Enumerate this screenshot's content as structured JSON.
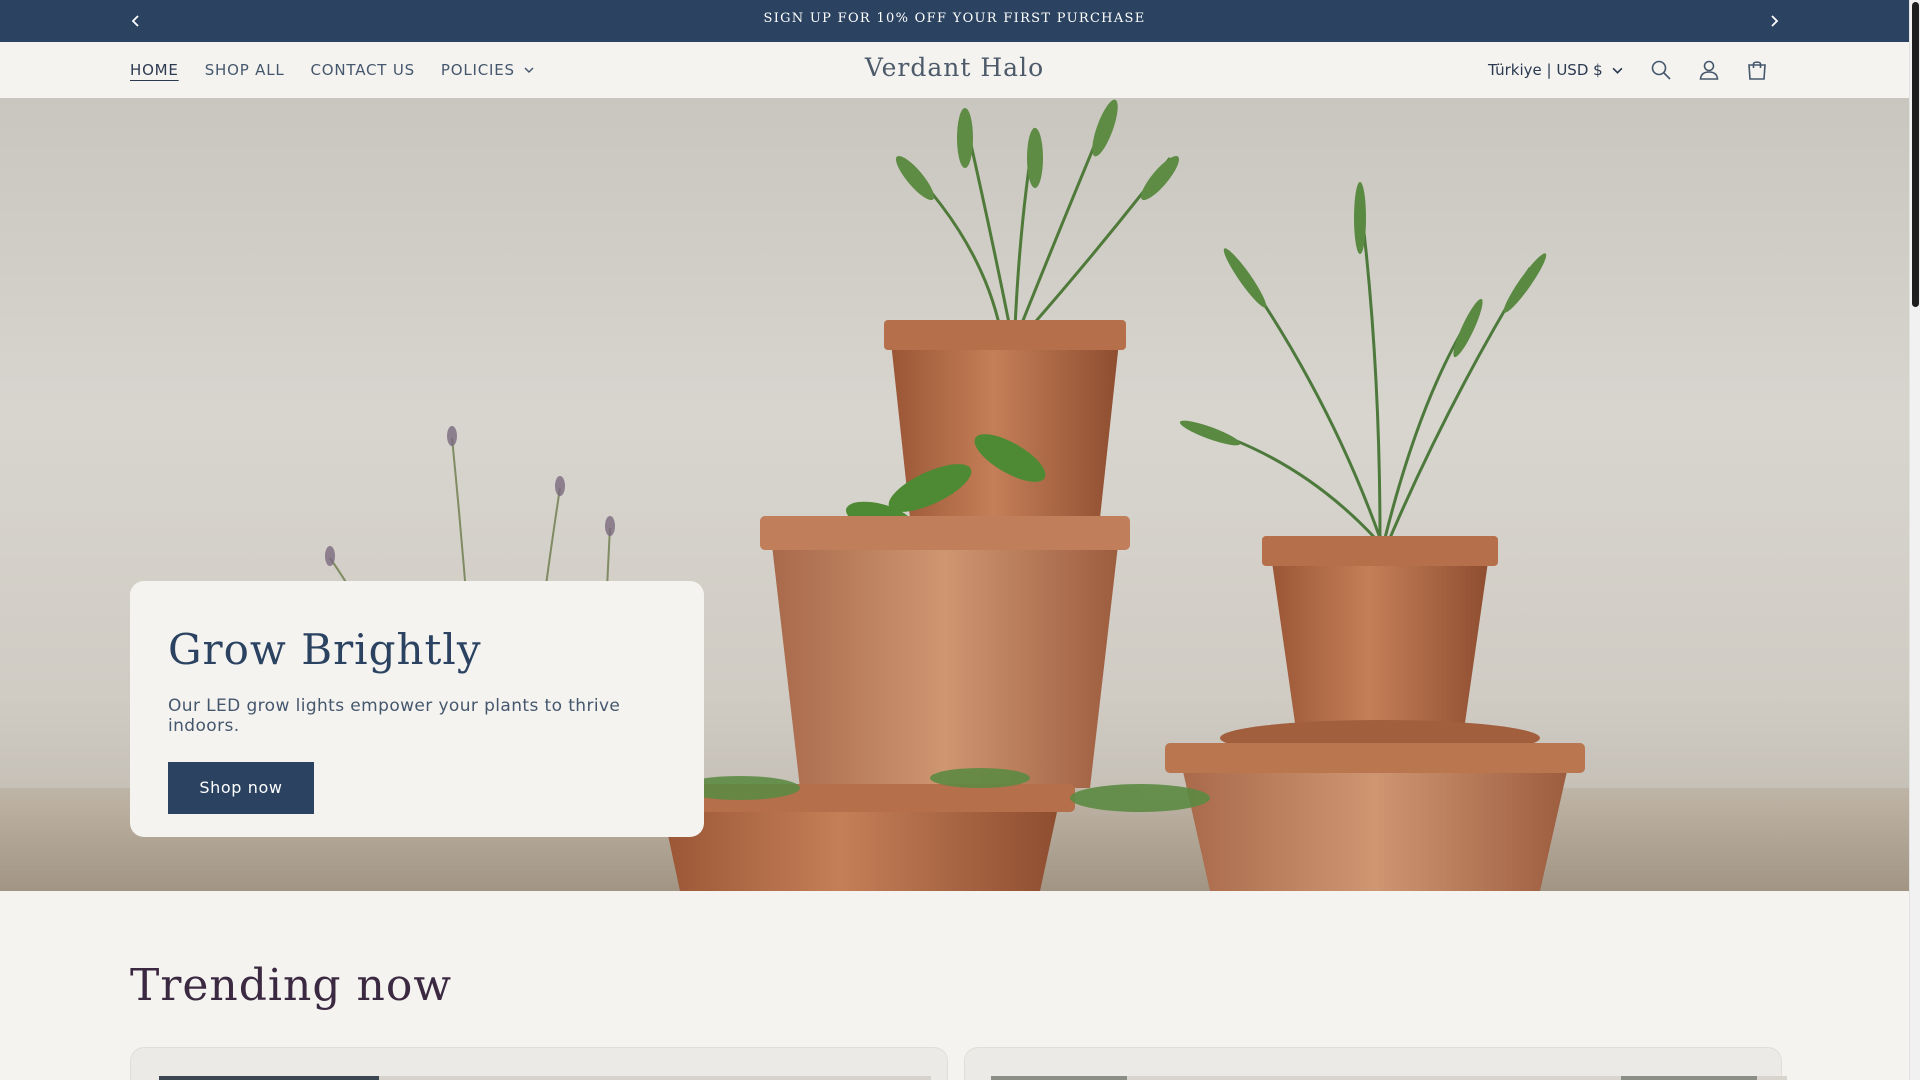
{
  "announcement": {
    "message": "SIGN UP FOR 10% OFF YOUR FIRST PURCHASE",
    "prev_icon": "chevron-left-icon",
    "next_icon": "chevron-right-icon"
  },
  "header": {
    "nav": [
      {
        "label": "HOME",
        "active": true
      },
      {
        "label": "SHOP ALL"
      },
      {
        "label": "CONTACT US"
      },
      {
        "label": "POLICIES",
        "has_dropdown": true
      }
    ],
    "logo": "Verdant Halo",
    "country_selector": "Türkiye | USD $",
    "icons": [
      "search-icon",
      "account-icon",
      "cart-icon"
    ]
  },
  "hero": {
    "title": "Grow Brightly",
    "text": "Our LED grow lights empower your plants to thrive indoors.",
    "button": "Shop now"
  },
  "trending": {
    "heading": "Trending now"
  },
  "colors": {
    "primary": "#2b4361",
    "background": "#f4f3f0",
    "trending_heading": "#3b2841",
    "terracotta": "#b8704a"
  }
}
